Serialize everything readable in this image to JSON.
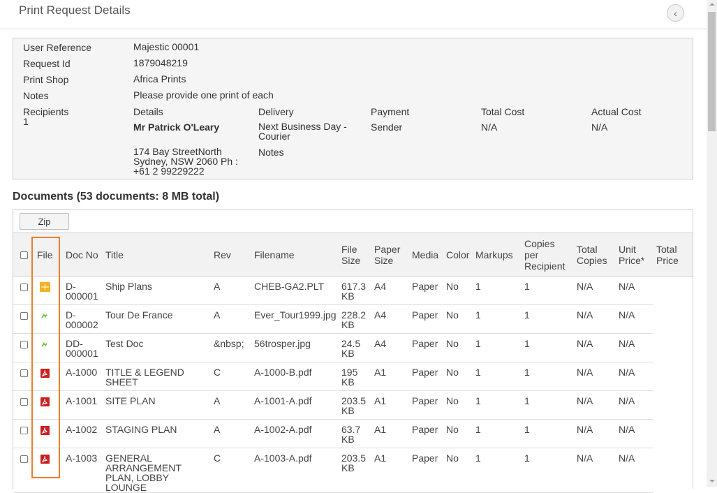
{
  "header": {
    "title": "Print Request Details",
    "back_icon": "chevron-left-icon",
    "back_glyph": "‹"
  },
  "details": {
    "user_reference_label": "User Reference",
    "user_reference": "Majestic 00001",
    "request_id_label": "Request Id",
    "request_id": "1879048219",
    "print_shop_label": "Print Shop",
    "print_shop": "Africa Prints",
    "notes_label": "Notes",
    "notes": "Please provide one print of each",
    "recipients_label": "Recipients",
    "recipients_count": "1",
    "columns": {
      "details": "Details",
      "delivery": "Delivery",
      "payment": "Payment",
      "total_cost": "Total Cost",
      "actual_cost": "Actual Cost"
    },
    "recipient": {
      "name": "Mr Patrick O'Leary",
      "address": "174 Bay StreetNorth Sydney, NSW 2060 Ph : +61 2 99229222",
      "delivery": "Next Business Day - Courier",
      "notes_label": "Notes",
      "payment": "Sender",
      "total_cost": "N/A",
      "actual_cost": "N/A"
    }
  },
  "documents": {
    "heading": "Documents (53 documents: 8 MB total)",
    "zip_label": "Zip",
    "columns": [
      "File",
      "Doc No",
      "Title",
      "Rev",
      "Filename",
      "File Size",
      "Paper Size",
      "Media",
      "Color",
      "Markups",
      "Copies per Recipient",
      "Total Copies",
      "Unit Price*",
      "Total Price"
    ],
    "rows": [
      {
        "icon": "plt-file-icon",
        "doc_no": "D-000001",
        "title": "Ship Plans",
        "rev": "A",
        "filename": "CHEB-GA2.PLT",
        "file_size": "617.3 KB",
        "paper_size": "A4",
        "media": "Paper",
        "color": "No",
        "markups": "1",
        "copies": "1",
        "total_copies": "N/A",
        "unit_price": "N/A"
      },
      {
        "icon": "image-file-icon",
        "doc_no": "D-000002",
        "title": "Tour De France",
        "rev": "A",
        "filename": "Ever_Tour1999.jpg",
        "file_size": "228.2 KB",
        "paper_size": "A4",
        "media": "Paper",
        "color": "No",
        "markups": "1",
        "copies": "1",
        "total_copies": "N/A",
        "unit_price": "N/A"
      },
      {
        "icon": "image-file-icon",
        "doc_no": "DD-000001",
        "title": "Test Doc",
        "rev": "&nbsp;",
        "filename": "56trosper.jpg",
        "file_size": "24.5 KB",
        "paper_size": "A4",
        "media": "Paper",
        "color": "No",
        "markups": "1",
        "copies": "1",
        "total_copies": "N/A",
        "unit_price": "N/A"
      },
      {
        "icon": "pdf-file-icon",
        "doc_no": "A-1000",
        "title": "TITLE & LEGEND SHEET",
        "rev": "C",
        "filename": "A-1000-B.pdf",
        "file_size": "195 KB",
        "paper_size": "A1",
        "media": "Paper",
        "color": "No",
        "markups": "1",
        "copies": "1",
        "total_copies": "N/A",
        "unit_price": "N/A"
      },
      {
        "icon": "pdf-file-icon",
        "doc_no": "A-1001",
        "title": "SITE PLAN",
        "rev": "A",
        "filename": "A-1001-A.pdf",
        "file_size": "203.5 KB",
        "paper_size": "A1",
        "media": "Paper",
        "color": "No",
        "markups": "1",
        "copies": "1",
        "total_copies": "N/A",
        "unit_price": "N/A"
      },
      {
        "icon": "pdf-file-icon",
        "doc_no": "A-1002",
        "title": "STAGING PLAN",
        "rev": "A",
        "filename": "A-1002-A.pdf",
        "file_size": "63.7 KB",
        "paper_size": "A1",
        "media": "Paper",
        "color": "No",
        "markups": "1",
        "copies": "1",
        "total_copies": "N/A",
        "unit_price": "N/A"
      },
      {
        "icon": "pdf-file-icon",
        "doc_no": "A-1003",
        "title": "GENERAL ARRANGEMENT PLAN, LOBBY LOUNGE",
        "rev": "C",
        "filename": "A-1003-A.pdf",
        "file_size": "203.5 KB",
        "paper_size": "A1",
        "media": "Paper",
        "color": "No",
        "markups": "1",
        "copies": "1",
        "total_copies": "N/A",
        "unit_price": "N/A"
      }
    ]
  },
  "colors": {
    "highlight": "#ef7d2b",
    "pdf_icon": "#cc1f1f",
    "plt_icon": "#f5b021",
    "image_icon": "#6fbf3a"
  }
}
